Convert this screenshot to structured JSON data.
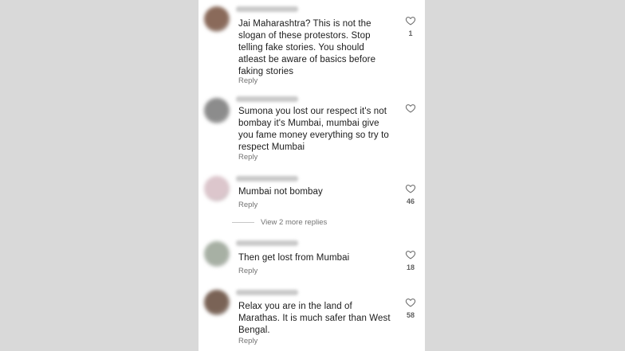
{
  "comments": [
    {
      "text": "Jai Maharashtra? This is not the\nslogan of these protestors. Stop\ntelling fake stories. You should\natleast be aware of basics before\nfaking stories",
      "reply_label": "Reply",
      "likes": "1",
      "avatar_color": "#8a6a5a"
    },
    {
      "text": "Sumona you lost our respect it's not\nbombay it's Mumbai, mumbai give\nyou fame money everything so try to\nrespect Mumbai",
      "reply_label": "Reply",
      "likes": "",
      "avatar_color": "#8c8c8c"
    },
    {
      "text": "Mumbai not bombay",
      "reply_label": "Reply",
      "likes": "46",
      "avatar_color": "#dcc6cc"
    },
    {
      "text": "Then get lost from Mumbai",
      "reply_label": "Reply",
      "likes": "18",
      "avatar_color": "#a7b0a4"
    },
    {
      "text": "Relax you are in the land of\nMarathas. It is much safer than West\nBengal.",
      "reply_label": "Reply",
      "likes": "58",
      "avatar_color": "#7a6356"
    }
  ],
  "view_more_replies": "View 2 more replies",
  "icons": {
    "like": "heart-outline-icon"
  },
  "colors": {
    "background_gutter": "#d9d9d9",
    "text": "#1b1b1b",
    "secondary_text": "#737373"
  }
}
